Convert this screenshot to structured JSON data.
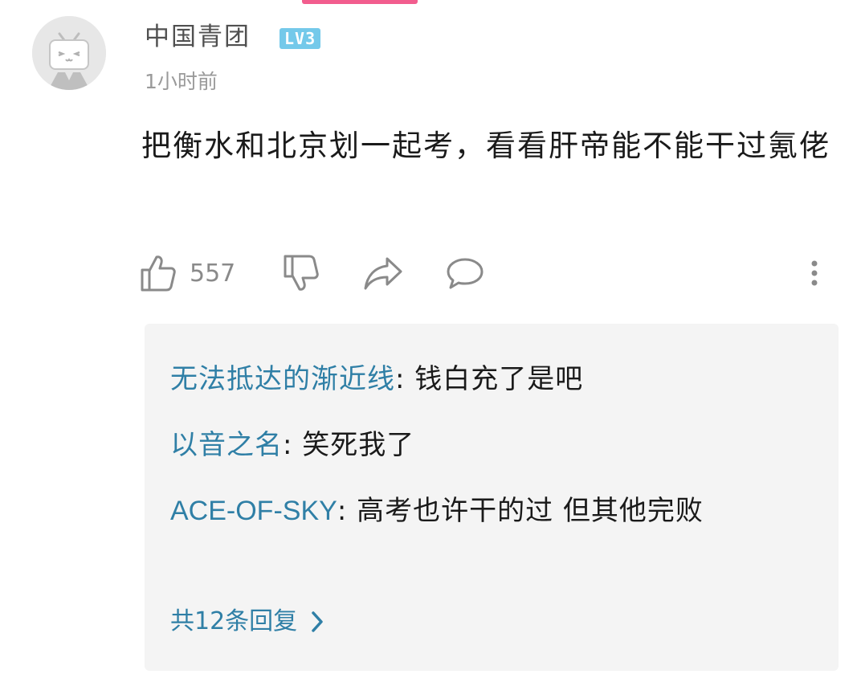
{
  "comment": {
    "username": "中国青团",
    "level": "LV3",
    "time": "1小时前",
    "text": "把衡水和北京划一起考，看看肝帝能不能干过氪佬",
    "likes": "557"
  },
  "replies": [
    {
      "name": "无法抵达的渐近线",
      "sep": ": ",
      "text": "钱白充了是吧"
    },
    {
      "name": "以音之名",
      "sep": ": ",
      "text": "笑死我了"
    },
    {
      "name": "ACE-OF-SKY",
      "sep": ": ",
      "text": "高考也许干的过 但其他完败"
    }
  ],
  "more_replies": "共12条回复",
  "colors": {
    "accent": "#f25d8e",
    "level_badge": "#74c9ea",
    "link": "#2f7fa6",
    "reply_bg": "#f4f4f4"
  },
  "icons": [
    "avatar-tv-icon",
    "thumbs-up-icon",
    "thumbs-down-icon",
    "share-icon",
    "comment-icon",
    "more-vertical-icon",
    "chevron-right-icon"
  ]
}
